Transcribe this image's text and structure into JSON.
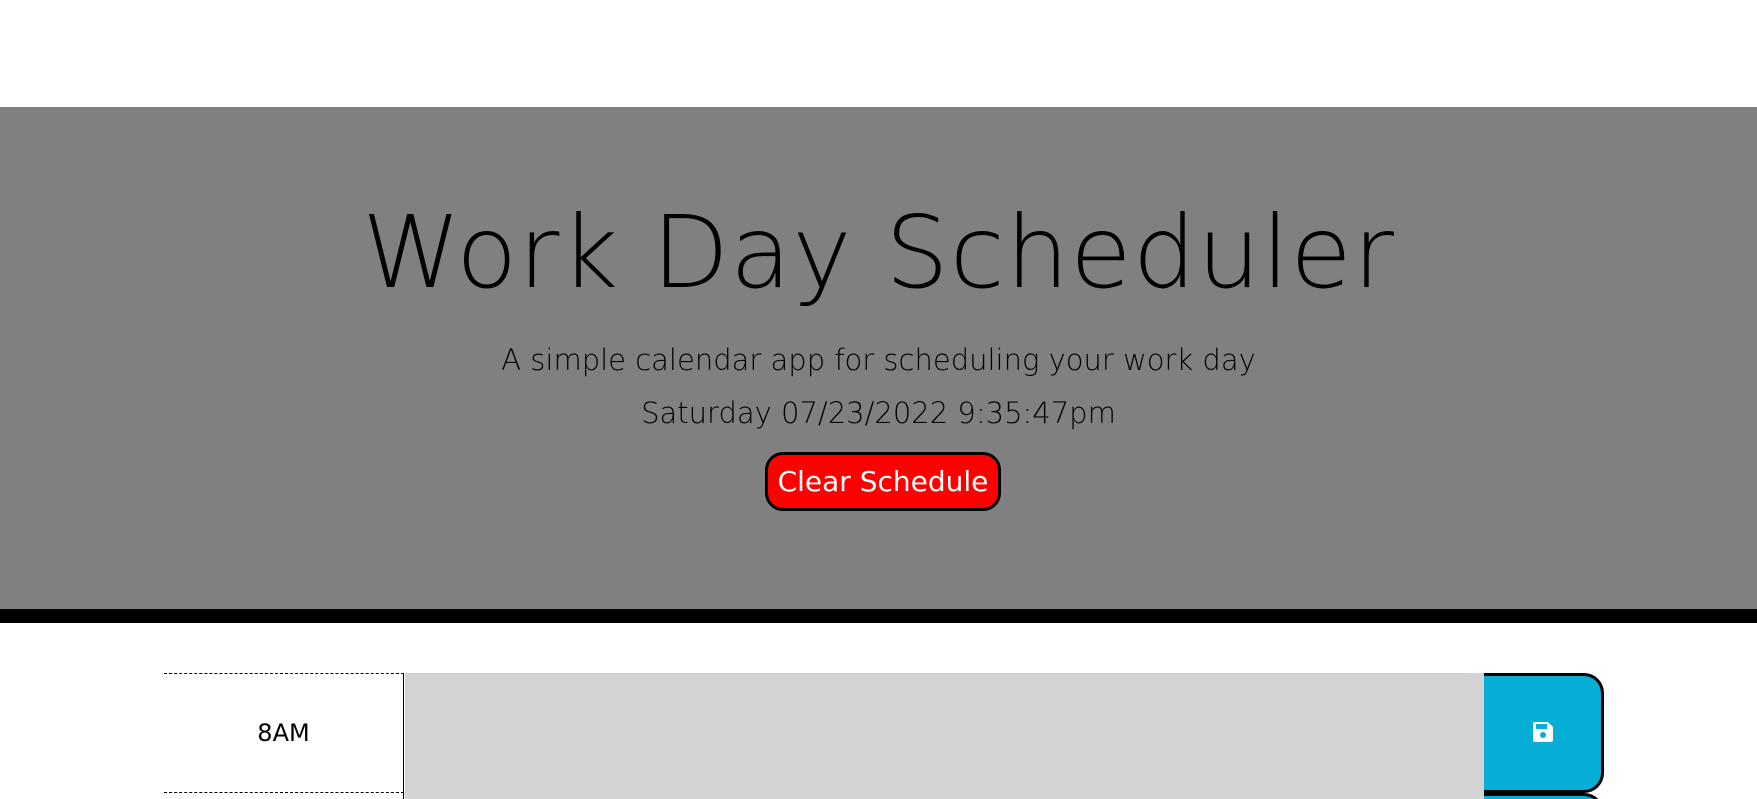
{
  "header": {
    "title": "Work Day Scheduler",
    "subtitle": "A simple calendar app for scheduling your work day",
    "current_day": "Saturday 07/23/2022 9:35:47pm",
    "clear_button_label": "Clear Schedule"
  },
  "schedule": {
    "rows": [
      {
        "hour": "8AM",
        "description": "",
        "save_icon": "floppy-disk-icon"
      }
    ]
  },
  "colors": {
    "jumbotron_bg": "#808080",
    "clear_button_bg": "#ff0000",
    "save_button_bg": "#06aed5",
    "past_row_bg": "#d3d3d3"
  }
}
